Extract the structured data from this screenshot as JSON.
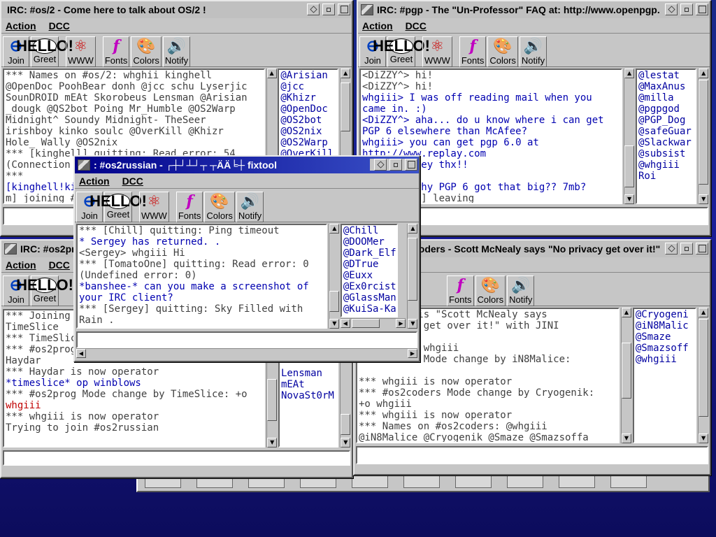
{
  "windows": {
    "os2": {
      "title": "IRC: #os/2 - Come here to talk about OS/2 !",
      "menu": [
        "Action",
        "DCC"
      ],
      "toolbar": [
        "Join",
        "Greet",
        "WWW",
        "Fonts",
        "Colors",
        "Notify"
      ],
      "chat": [
        {
          "text": "*** Names on #os/2: whghii kinghell",
          "cls": ""
        },
        {
          "text": "@OpenDoc PoohBear donh @jcc schu Lyserjic",
          "cls": ""
        },
        {
          "text": "SounDROID mEAt Skorobeus Lensman @Arisian",
          "cls": ""
        },
        {
          "text": "_dougk @QS2bot Poing Mr_Humble @OS2Warp",
          "cls": ""
        },
        {
          "text": "Midnight^ Soundy Midnight- TheSeer",
          "cls": ""
        },
        {
          "text": "irishboy kinko soulc @OverKill @Khizr",
          "cls": ""
        },
        {
          "text": "Hole_ Wally @OS2nix",
          "cls": ""
        },
        {
          "text": "*** [kinghell] quitting: Read error: 54",
          "cls": ""
        },
        {
          "text": "(Connection",
          "cls": ""
        },
        {
          "text": "***",
          "cls": ""
        },
        {
          "text": "[kinghell!ki",
          "cls": "blue"
        },
        {
          "text": "m] joining #",
          "cls": ""
        }
      ],
      "users": [
        "@Arisian",
        "@jcc",
        "@Khizr",
        "@OpenDoc",
        "@OS2bot",
        "@OS2nix",
        "@OS2Warp",
        "@OverKill"
      ]
    },
    "pgp": {
      "title": "IRC: #pgp - The \"Un-Professor\" FAQ at: http://www.openpgp.",
      "menu": [
        "Action",
        "DCC"
      ],
      "toolbar": [
        "Join",
        "Greet",
        "WWW",
        "Fonts",
        "Colors",
        "Notify"
      ],
      "chat": [
        {
          "text": "<DiZZY^> hi!",
          "cls": ""
        },
        {
          "text": "<DiZZY^> hi!",
          "cls": ""
        },
        {
          "text": "whgiii> I was off reading mail when you",
          "cls": "blue"
        },
        {
          "text": "came in. :)",
          "cls": "blue"
        },
        {
          "text": "<DiZZY^> aha... do u know where i can get",
          "cls": "blue"
        },
        {
          "text": "PGP 6 elsewhere than McAfee?",
          "cls": "blue"
        },
        {
          "text": "whgiii> you can get pgp 6.0 at",
          "cls": "blue"
        },
        {
          "text": "http://www.replay.com",
          "cls": "blue"
        },
        {
          "text": "<DiZZY^> hey thx!!",
          "cls": "blue"
        },
        {
          "text": "",
          "cls": ""
        },
        {
          "text": "<DiZZY^> why PGP 6 got that big?? 7mb?",
          "cls": "blue"
        },
        {
          "text": "*** DiZZY^] leaving",
          "cls": ""
        }
      ],
      "users": [
        "@lestat",
        "@MaxAnus",
        "@milla",
        "@pgpgod",
        "@PGP_Dog",
        "@safeGuar",
        "@Slackwar",
        "@subsist",
        "@whgiii",
        "Roi"
      ]
    },
    "os2prog": {
      "title": "IRC: #os2prog",
      "menu": [
        "Action",
        "DCC"
      ],
      "toolbar": [
        "Join",
        "Greet"
      ],
      "chat": [
        {
          "text": "*** Joining #os2prog",
          "cls": ""
        },
        {
          "text": "TimeSlice",
          "cls": ""
        },
        {
          "text": "*** TimeSlice",
          "cls": ""
        },
        {
          "text": "*** #os2prog",
          "cls": ""
        },
        {
          "text": "Haydar",
          "cls": ""
        },
        {
          "text": "*** Haydar is now operator",
          "cls": ""
        },
        {
          "text": "*timeslice* op winblows",
          "cls": "blue"
        },
        {
          "text": "*** #os2prog Mode change by TimeSlice: +o",
          "cls": ""
        },
        {
          "text": "whgiii",
          "cls": "red"
        },
        {
          "text": "*** whgiii is now operator",
          "cls": ""
        },
        {
          "text": "Trying to join #os2russian",
          "cls": ""
        }
      ],
      "users": [
        "Lensman",
        "mEAt",
        "NovaSt0rM"
      ]
    },
    "os2coders": {
      "title": "coders - Scott McNealy says \"No privacy get over it!\"",
      "toolbar": [
        "Fonts",
        "Colors",
        "Notify"
      ],
      "chat": [
        {
          "text": "*** Topic is \"Scott McNealy says",
          "cls": ""
        },
        {
          "text": "No privacy get over it!\" with JINI",
          "cls": ""
        },
        {
          "text": "cooties!!",
          "cls": ""
        },
        {
          "text": "*** Set by whgiii",
          "cls": ""
        },
        {
          "text": "*** coders Mode change by iN8Malice:",
          "cls": ""
        },
        {
          "text": "",
          "cls": ""
        },
        {
          "text": "*** whgiii is now operator",
          "cls": ""
        },
        {
          "text": "*** #os2coders Mode change by Cryogenik:",
          "cls": ""
        },
        {
          "text": "+o whgiii",
          "cls": ""
        },
        {
          "text": "*** whgiii is now operator",
          "cls": ""
        },
        {
          "text": "*** Names on #os2coders: @whgiii",
          "cls": ""
        },
        {
          "text": "@iN8Malice @Cryogenik @Smaze @Smazsoffa",
          "cls": ""
        }
      ],
      "users": [
        "@Cryogeni",
        "@iN8Malic",
        "@Smaze",
        "@Smazsoff",
        "@whgiii"
      ]
    },
    "os2russian": {
      "title": ": #os2russian - ┌┼┘┴┘┬ ┬ÄÄ╘┼ fixtool",
      "menu": [
        "Action",
        "DCC"
      ],
      "toolbar": [
        "Join",
        "Greet",
        "WWW",
        "Fonts",
        "Colors",
        "Notify"
      ],
      "chat": [
        {
          "text": "*** [Chill] quitting: Ping timeout",
          "cls": ""
        },
        {
          "text": "* Sergey has returned. .",
          "cls": "blue"
        },
        {
          "text": "<Sergey> whgiii Hi",
          "cls": ""
        },
        {
          "text": "*** [TomatoOne] quitting: Read error: 0",
          "cls": ""
        },
        {
          "text": "(Undefined error: 0)",
          "cls": ""
        },
        {
          "text": "*banshee-* can you make a screenshot of",
          "cls": "blue"
        },
        {
          "text": "your IRC client?",
          "cls": "blue"
        },
        {
          "text": "*** [Sergey] quitting: Sky Filled with",
          "cls": ""
        },
        {
          "text": "Rain .",
          "cls": ""
        }
      ],
      "users": [
        "@Chill",
        "@DOOMer",
        "@Dark_Elf",
        "@DTrue",
        "@Euxx",
        "@Ex0rcist",
        "@GlassMan",
        "@KuiSa-Ka"
      ]
    }
  },
  "colors": {
    "active_title": "#00008a",
    "nick_blue": "#0000b0",
    "nick_red": "#c00000",
    "desktop": "#1a1f96"
  },
  "icons": [
    "join-icon",
    "greet-icon",
    "www-icon",
    "fonts-icon",
    "colors-icon",
    "notify-icon"
  ]
}
